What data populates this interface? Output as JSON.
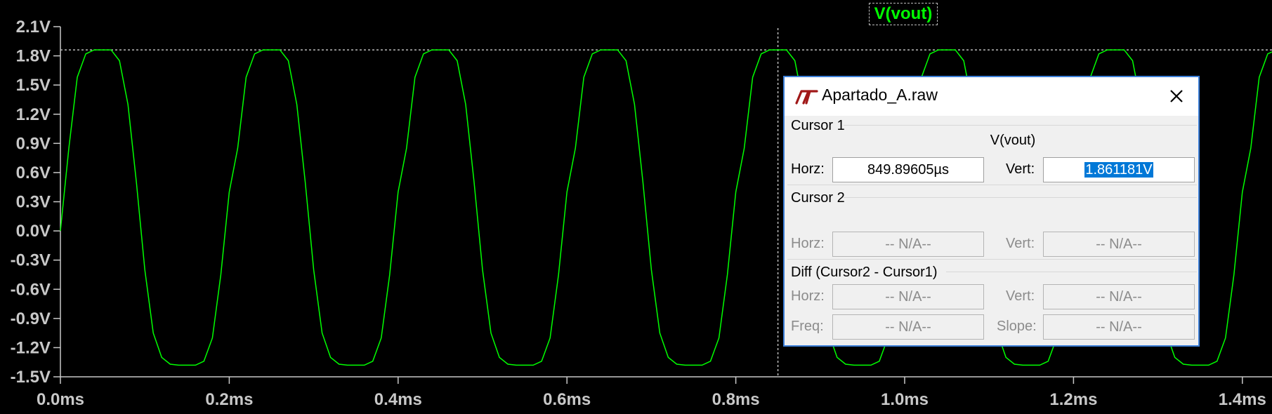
{
  "window": {
    "trace_title": "V(vout)",
    "colors": {
      "background": "#000000",
      "trace": "#00ff00",
      "axis": "#c8c8c8",
      "dialog_border": "#3c7fd8",
      "selection": "#0078d7"
    }
  },
  "chart_data": {
    "type": "line",
    "title": "V(vout)",
    "xlabel": "",
    "ylabel": "",
    "x_unit": "ms",
    "xlim": [
      0.0,
      1.44
    ],
    "ylim": [
      -1.5,
      2.1
    ],
    "x_ticks": [
      "0.0ms",
      "0.2ms",
      "0.4ms",
      "0.6ms",
      "0.8ms",
      "1.0ms",
      "1.2ms",
      "1.4ms"
    ],
    "y_ticks": [
      "2.1V",
      "1.8V",
      "1.5V",
      "1.2V",
      "0.9V",
      "0.6V",
      "0.3V",
      "0.0V",
      "-0.3V",
      "-0.6V",
      "-0.9V",
      "-1.2V",
      "-1.5V"
    ],
    "series": [
      {
        "name": "V(vout)",
        "period_ms": 0.2,
        "max_V": 1.861,
        "min_V": -1.38,
        "x": [
          0,
          0.01,
          0.02,
          0.03,
          0.04,
          0.05,
          0.06,
          0.07,
          0.08,
          0.09,
          0.1,
          0.11,
          0.12,
          0.13,
          0.14,
          0.15,
          0.16,
          0.17,
          0.18,
          0.19,
          0.2
        ],
        "y": [
          0.0,
          0.85,
          1.58,
          1.82,
          1.861,
          1.861,
          1.861,
          1.75,
          1.3,
          0.5,
          -0.4,
          -1.05,
          -1.3,
          -1.37,
          -1.38,
          -1.38,
          -1.38,
          -1.34,
          -1.1,
          -0.45,
          0.4
        ]
      }
    ],
    "cursor": {
      "x_ms": 0.84989605,
      "y_V": 1.861181
    },
    "grid": false,
    "legend": "none"
  },
  "dialog": {
    "title": "Apartado_A.raw",
    "app_icon": "ltspice-logo-icon",
    "close_icon": "close-icon",
    "cursor1": {
      "label": "Cursor 1",
      "trace_name": "V(vout)",
      "horz_label": "Horz:",
      "horz_value": "849.89605µs",
      "vert_label": "Vert:",
      "vert_value": "1.861181V"
    },
    "cursor2": {
      "label": "Cursor 2",
      "horz_label": "Horz:",
      "horz_value": "-- N/A--",
      "vert_label": "Vert:",
      "vert_value": "-- N/A--"
    },
    "diff": {
      "label": "Diff (Cursor2 - Cursor1)",
      "horz_label": "Horz:",
      "horz_value": "-- N/A--",
      "vert_label": "Vert:",
      "vert_value": "-- N/A--",
      "freq_label": "Freq:",
      "freq_value": "-- N/A--",
      "slope_label": "Slope:",
      "slope_value": "-- N/A--"
    }
  }
}
